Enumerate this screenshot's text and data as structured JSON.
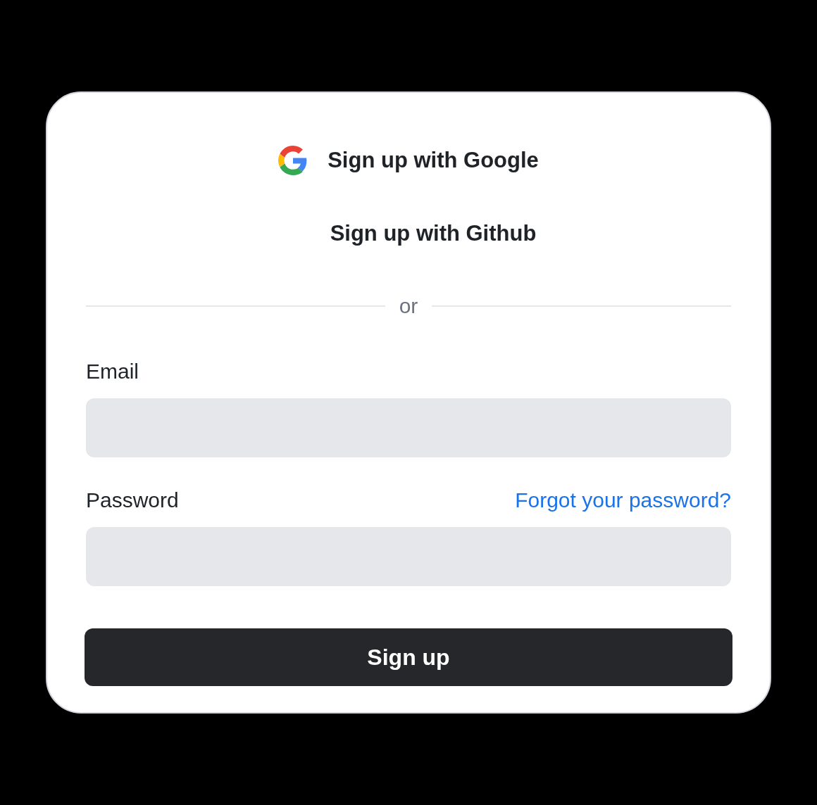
{
  "social_buttons": [
    {
      "kind": "google",
      "label": "Sign up with Google"
    },
    {
      "kind": "github",
      "label": "Sign up with Github"
    }
  ],
  "divider": "or",
  "email": {
    "label": "Email"
  },
  "password": {
    "label": "Password",
    "forgot_link": "Forgot your password?"
  },
  "submit": "Sign up"
}
